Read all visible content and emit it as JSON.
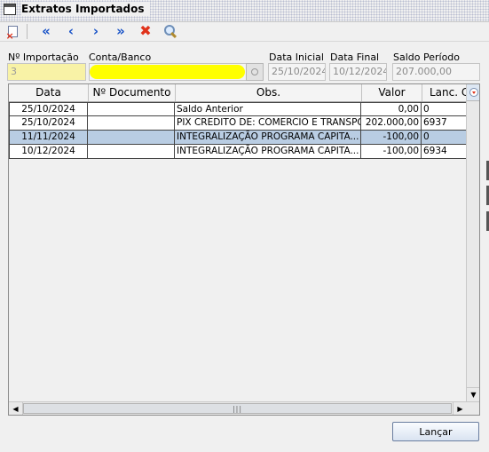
{
  "window": {
    "title": "Extratos Importados"
  },
  "toolbar": {
    "items": [
      {
        "name": "close-doc-icon",
        "glyph": ""
      },
      {
        "name": "first-record-icon",
        "glyph": "«"
      },
      {
        "name": "previous-record-icon",
        "glyph": "‹"
      },
      {
        "name": "next-record-icon",
        "glyph": "›"
      },
      {
        "name": "last-record-icon",
        "glyph": "»"
      },
      {
        "name": "delete-icon",
        "glyph": "✖"
      },
      {
        "name": "search-icon",
        "glyph": ""
      }
    ]
  },
  "filters": {
    "importacao_label": "Nº Importação",
    "importacao_value": "3",
    "conta_label": "Conta/Banco",
    "conta_value": "",
    "data_inicial_label": "Data Inicial",
    "data_inicial_value": "25/10/2024",
    "data_final_label": "Data Final",
    "data_final_value": "10/12/2024",
    "saldo_label": "Saldo Período",
    "saldo_value": "207.000,00"
  },
  "grid": {
    "columns": [
      "Data",
      "Nº Documento",
      "Obs.",
      "Valor",
      "Lanc. C"
    ],
    "rows": [
      {
        "data": "25/10/2024",
        "documento": "",
        "obs": "Saldo Anterior",
        "valor": "0,00",
        "lanc": "0",
        "selected": false
      },
      {
        "data": "25/10/2024",
        "documento": "",
        "obs": "PIX CREDITO DE: COMERCIO E TRANSPO...",
        "valor": "202.000,00",
        "lanc": "6937",
        "selected": false
      },
      {
        "data": "11/11/2024",
        "documento": "",
        "obs": "INTEGRALIZAÇÃO PROGRAMA CAPITA...",
        "valor": "-100,00",
        "lanc": "0",
        "selected": true
      },
      {
        "data": "10/12/2024",
        "documento": "",
        "obs": "INTEGRALIZAÇÃO PROGRAMA CAPITA...",
        "valor": "-100,00",
        "lanc": "6934",
        "selected": false
      }
    ]
  },
  "actions": {
    "lancar_label": "Lançar"
  },
  "colors": {
    "selected_row": "#b9cde3",
    "highlight": "#ffff00",
    "toolbar_blue": "#1550c7",
    "toolbar_red": "#e0331b"
  }
}
